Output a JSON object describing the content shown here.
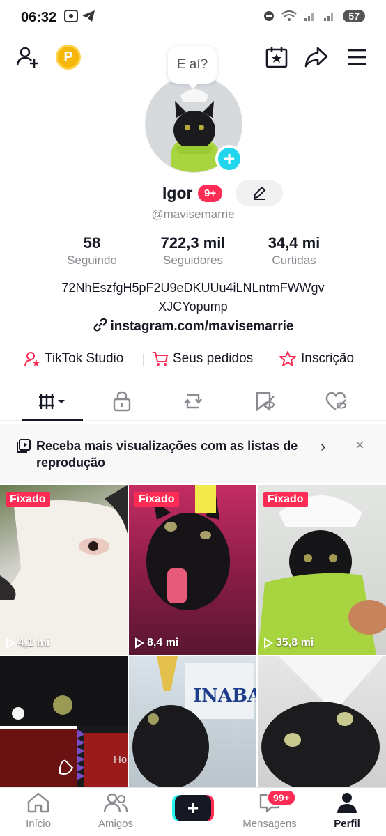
{
  "status_bar": {
    "time": "06:32",
    "battery": "57",
    "icons": [
      "screenshot-icon",
      "telegram-icon",
      "dnd-icon",
      "wifi-icon",
      "signal-icon",
      "signal-icon",
      "battery-icon"
    ]
  },
  "topbar": {
    "coin_letter": "P"
  },
  "profile": {
    "bubble_text": "E aí?",
    "name": "Igor",
    "badge": "9+",
    "handle": "@mavisemarrie",
    "stats": [
      {
        "value": "58",
        "label": "Seguindo"
      },
      {
        "value": "722,3 mil",
        "label": "Seguidores"
      },
      {
        "value": "34,4 mi",
        "label": "Curtidas"
      }
    ],
    "bio_line1": "72NhEszfgH5pF2U9eDKUUu4iLNLntmFWWgv",
    "bio_line2": "XJCYopump",
    "link": "instagram.com/mavisemarrie"
  },
  "actions": [
    {
      "label": "TikTok Studio",
      "icon": "studio-icon"
    },
    {
      "label": "Seus pedidos",
      "icon": "cart-icon"
    },
    {
      "label": "Inscrição",
      "icon": "subscription-icon"
    }
  ],
  "promo": {
    "text": "Receba mais visualizações com as listas de reprodução"
  },
  "videos": [
    {
      "pinned": "Fixado",
      "views": "4,1 mi"
    },
    {
      "pinned": "Fixado",
      "views": "8,4 mi"
    },
    {
      "pinned": "Fixado",
      "views": "35,8 mi"
    },
    {
      "pinned": "",
      "views": "",
      "overlay_text": "Ho"
    },
    {
      "pinned": "",
      "views": "",
      "overlay_text": "INABA"
    },
    {
      "pinned": "",
      "views": ""
    }
  ],
  "bottom_nav": {
    "home": "Início",
    "friends": "Amigos",
    "messages": "Mensagens",
    "messages_badge": "99+",
    "profile": "Perfil",
    "create": "+"
  },
  "colors": {
    "accent": "#fe2c55",
    "cyan": "#25f4ee",
    "text": "#161823",
    "muted": "#8a8b91"
  }
}
